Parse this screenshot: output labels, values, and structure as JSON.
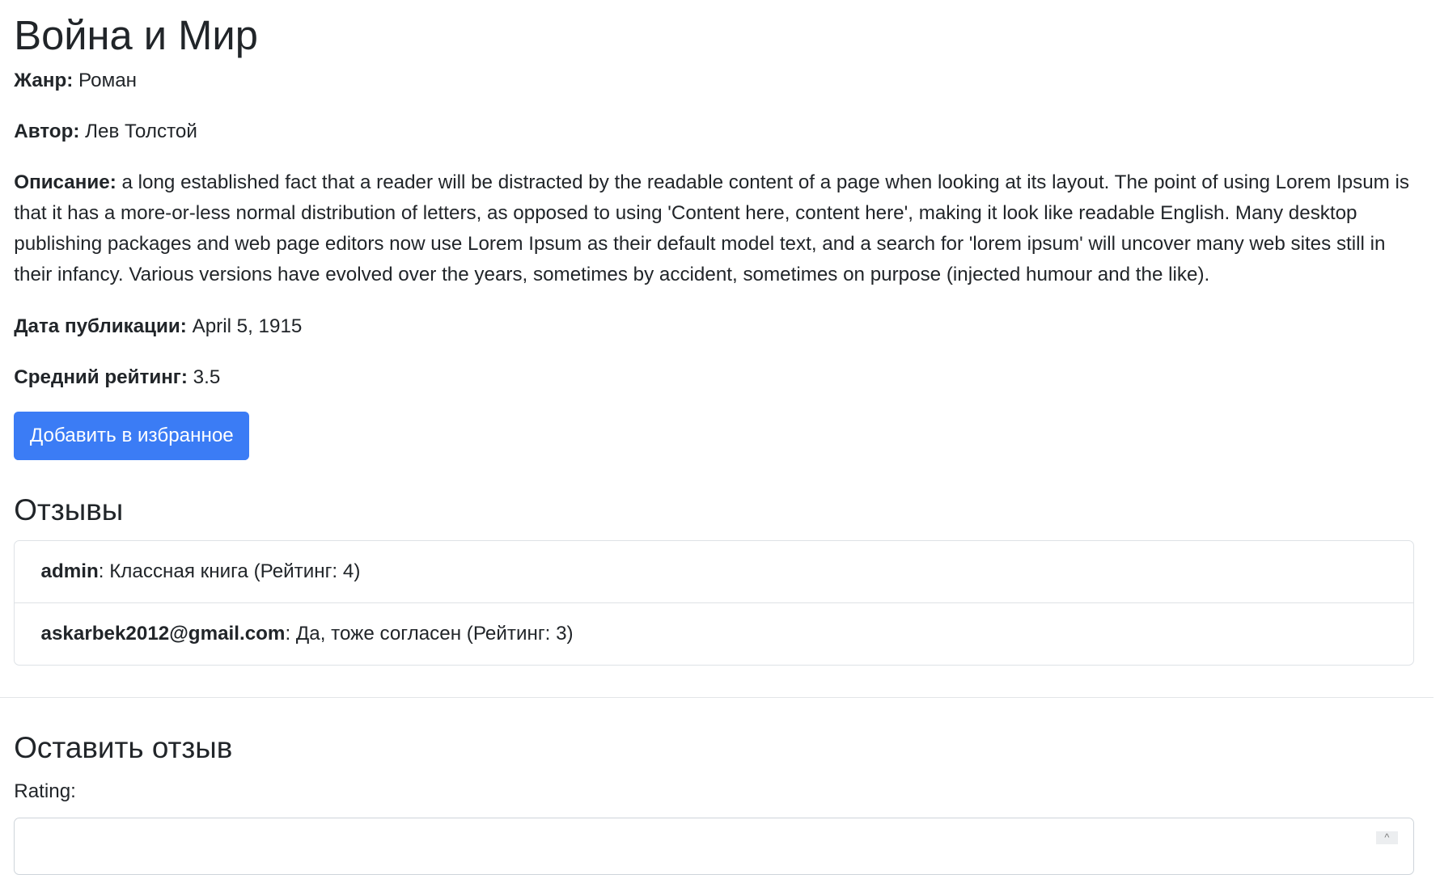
{
  "book": {
    "title": "Война и Мир",
    "genre_label": "Жанр:",
    "genre": "Роман",
    "author_label": "Автор:",
    "author": "Лев Толстой",
    "description_label": "Описание:",
    "description": "a long established fact that a reader will be distracted by the readable content of a page when looking at its layout. The point of using Lorem Ipsum is that it has a more-or-less normal distribution of letters, as opposed to using 'Content here, content here', making it look like readable English. Many desktop publishing packages and web page editors now use Lorem Ipsum as their default model text, and a search for 'lorem ipsum' will uncover many web sites still in their infancy. Various versions have evolved over the years, sometimes by accident, sometimes on purpose (injected humour and the like).",
    "date_label": "Дата публикации:",
    "date": "April 5, 1915",
    "rating_label": "Средний рейтинг:",
    "rating": "3.5",
    "favorite_button": "Добавить в избранное"
  },
  "reviews": {
    "title": "Отзывы",
    "items": [
      {
        "user": "admin",
        "text": ": Классная книга (Рейтинг: 4)"
      },
      {
        "user": "askarbek2012@gmail.com",
        "text": ": Да, тоже согласен (Рейтинг: 3)"
      }
    ]
  },
  "form": {
    "title": "Оставить отзыв",
    "rating_label": "Rating:",
    "spinner_glyph": "^"
  },
  "colors": {
    "accent": "#3b7cf5",
    "text": "#212529"
  }
}
